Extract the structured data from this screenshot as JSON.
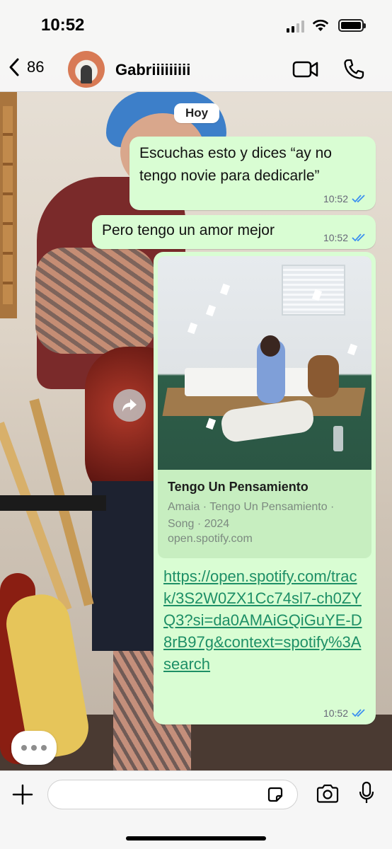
{
  "status_bar": {
    "time": "10:52",
    "battery_level": 1.0
  },
  "header": {
    "back_count": "86",
    "contact_name": "Gabriiiiiiiii",
    "icons": [
      "chevron-left-icon",
      "video-call-icon",
      "phone-icon"
    ]
  },
  "date_divider": "Hoy",
  "messages": [
    {
      "text": "Escuchas esto y dices “ay no tengo novie para dedicarle”",
      "time": "10:52",
      "status": "read"
    },
    {
      "text": "Pero tengo un amor mejor",
      "time": "10:52",
      "status": "read"
    },
    {
      "link_preview": {
        "title": "Tengo Un Pensamiento",
        "subtitle": "Amaia · Tengo Un Pensamiento · Song · 2024",
        "domain": "open.spotify.com"
      },
      "text": "https://open.spotify.com/track/3S2W0ZX1Cc74sl7-ch0ZYQ3?si=da0AMAiGQiGuYE-D8rB97g&context=spotify%3Asearch",
      "time": "10:52",
      "status": "read"
    }
  ],
  "input": {
    "placeholder": ""
  },
  "colors": {
    "bubble_out": "#d9fdd3",
    "link": "#1d8f66",
    "read_ticks": "#3b8ff0"
  }
}
